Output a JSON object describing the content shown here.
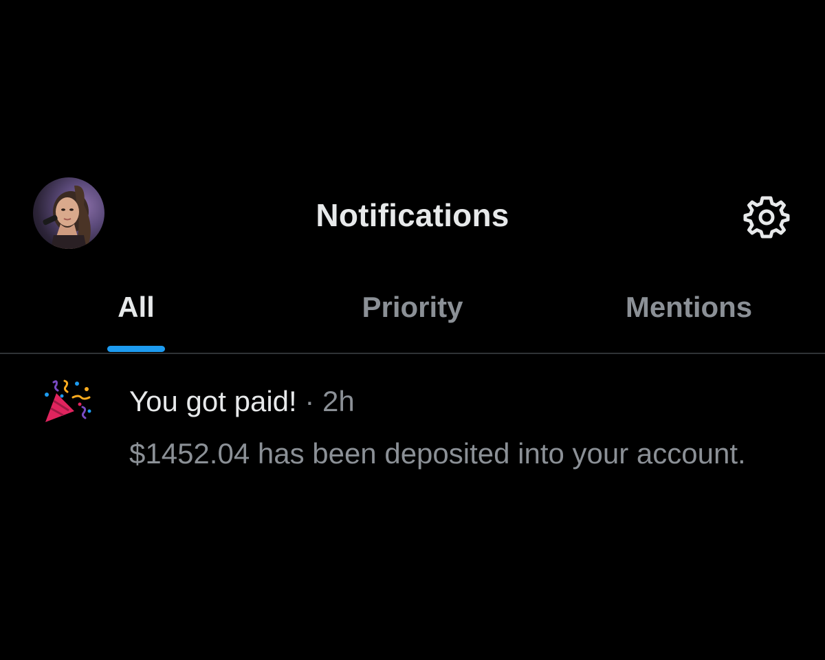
{
  "header": {
    "title": "Notifications",
    "avatar_icon": "profile-avatar",
    "settings_icon": "gear-icon"
  },
  "tabs": [
    {
      "label": "All",
      "active": true
    },
    {
      "label": "Priority",
      "active": false
    },
    {
      "label": "Mentions",
      "active": false
    }
  ],
  "notification": {
    "icon": "party-popper-icon",
    "title": "You got paid!",
    "separator": "·",
    "time": "2h",
    "body": "$1452.04 has been deposited into your account."
  },
  "colors": {
    "background": "#000000",
    "text_primary": "#e7e9ea",
    "text_secondary": "#8b9096",
    "accent": "#1d9bf0",
    "divider": "#2f3336"
  }
}
